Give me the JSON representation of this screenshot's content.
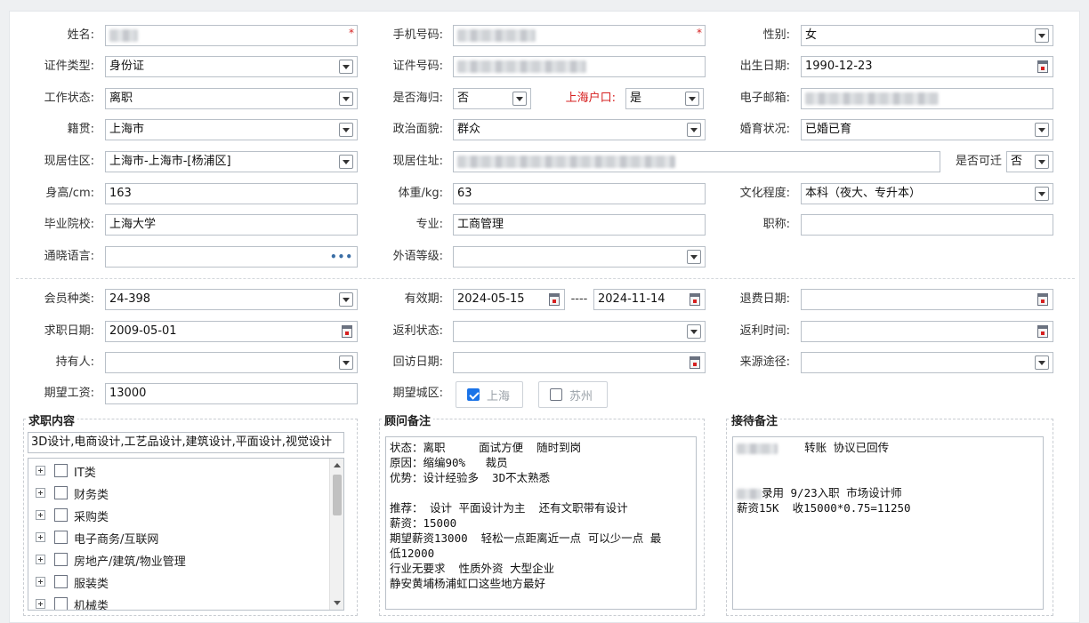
{
  "basic": {
    "name_label": "姓名:",
    "phone_label": "手机号码:",
    "gender_label": "性别:",
    "gender_value": "女",
    "id_type_label": "证件类型:",
    "id_type_value": "身份证",
    "id_no_label": "证件号码:",
    "birth_label": "出生日期:",
    "birth_value": "1990-12-23",
    "work_status_label": "工作状态:",
    "work_status_value": "离职",
    "returnee_label": "是否海归:",
    "returnee_value": "否",
    "hukou_label": "上海户口:",
    "hukou_value": "是",
    "email_label": "电子邮箱:",
    "native_label": "籍贯:",
    "native_value": "上海市",
    "political_label": "政治面貌:",
    "political_value": "群众",
    "marital_label": "婚育状况:",
    "marital_value": "已婚已育",
    "residence_label": "现居住区:",
    "residence_value": "上海市-上海市-[杨浦区]",
    "address_label": "现居住址:",
    "relocate_label": "是否可迁",
    "relocate_value": "否",
    "height_label": "身高/cm:",
    "height_value": "163",
    "weight_label": "体重/kg:",
    "weight_value": "63",
    "education_label": "文化程度:",
    "education_value": "本科（夜大、专升本）",
    "school_label": "毕业院校:",
    "school_value": "上海大学",
    "major_label": "专业:",
    "major_value": "工商管理",
    "title_label": "职称:",
    "language_label": "通晓语言:",
    "language_more": "•••",
    "foreign_level_label": "外语等级:",
    "required_mark": "*"
  },
  "membership": {
    "member_type_label": "会员种类:",
    "member_type_value": "24-398",
    "validity_label": "有效期:",
    "validity_start": "2024-05-15",
    "validity_sep": "----",
    "validity_end": "2024-11-14",
    "refund_date_label": "退费日期:",
    "job_date_label": "求职日期:",
    "job_date_value": "2009-05-01",
    "rebate_status_label": "返利状态:",
    "rebate_time_label": "返利时间:",
    "holder_label": "持有人:",
    "visit_date_label": "回访日期:",
    "source_label": "来源途径:",
    "salary_label": "期望工资:",
    "salary_value": "13000",
    "city_label": "期望城区:",
    "cities": [
      {
        "name": "上海",
        "checked": true
      },
      {
        "name": "苏州",
        "checked": false
      }
    ]
  },
  "job_content": {
    "legend": "求职内容",
    "summary": "3D设计,电商设计,工艺品设计,建筑设计,平面设计,视觉设计",
    "tree": [
      {
        "label": "IT类"
      },
      {
        "label": "财务类"
      },
      {
        "label": "采购类"
      },
      {
        "label": "电子商务/互联网"
      },
      {
        "label": "房地产/建筑/物业管理"
      },
      {
        "label": "服装类"
      },
      {
        "label": "机械类"
      }
    ]
  },
  "consultant_notes": {
    "legend": "顾问备注",
    "lines": [
      "状态：离职     面试方便  随时到岗",
      "原因：缩编90%   裁员",
      "优势：设计经验多  3D不太熟悉",
      "",
      "推荐： 设计 平面设计为主  还有文职带有设计",
      "薪资：15000",
      "期望薪资13000  轻松一点距离近一点 可以少一点 最",
      "低12000",
      "行业无要求  性质外资 大型企业",
      "静安黄埔杨浦虹口这些地方最好"
    ]
  },
  "reception_notes": {
    "legend": "接待备注",
    "line1": "转账 协议已回传",
    "line2": "录用 9/23入职 市场设计师",
    "line3": "薪资15K  收15000*0.75=11250"
  },
  "colors": {
    "required": "#d62020",
    "accent": "#1a73e8"
  }
}
